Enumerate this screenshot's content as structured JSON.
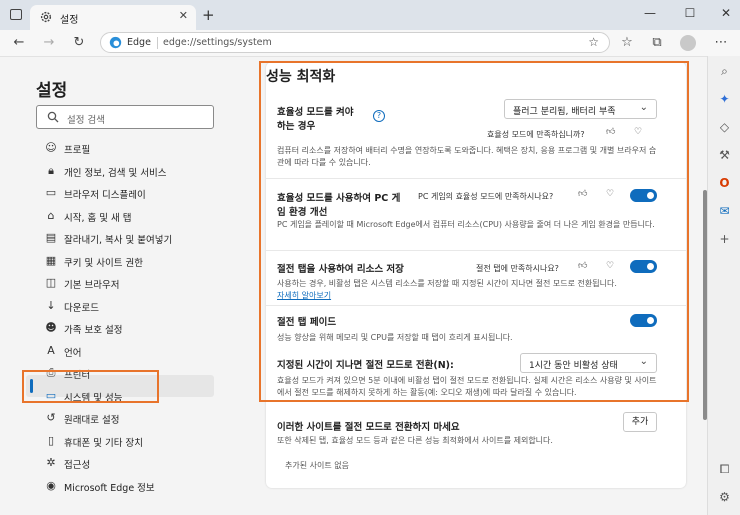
{
  "browser": {
    "tab_title": "설정",
    "new_tab": "+",
    "close": "✕",
    "minimize": "—",
    "maximize": "☐",
    "address_brand": "Edge",
    "address_url": "edge://settings/system"
  },
  "sidebar": {
    "title": "설정",
    "search_placeholder": "설정 검색",
    "items": [
      {
        "label": "프로필",
        "icon": "profile-icon"
      },
      {
        "label": "개인 정보, 검색 및 서비스",
        "icon": "lock-icon"
      },
      {
        "label": "브라우저 디스플레이",
        "icon": "display-icon"
      },
      {
        "label": "시작, 홈 및 새 탭",
        "icon": "home-icon"
      },
      {
        "label": "잘라내기, 복사 및 붙여넣기",
        "icon": "clipboard-icon"
      },
      {
        "label": "쿠키 및 사이트 권한",
        "icon": "cookie-icon"
      },
      {
        "label": "기본 브라우저",
        "icon": "browser-icon"
      },
      {
        "label": "다운로드",
        "icon": "download-icon"
      },
      {
        "label": "가족 보호 설정",
        "icon": "family-icon"
      },
      {
        "label": "언어",
        "icon": "language-icon"
      },
      {
        "label": "프린터",
        "icon": "printer-icon"
      },
      {
        "label": "시스템 및 성능",
        "icon": "system-icon",
        "active": true
      },
      {
        "label": "원래대로 설정",
        "icon": "reset-icon"
      },
      {
        "label": "휴대폰 및 기타 장치",
        "icon": "phone-icon"
      },
      {
        "label": "접근성",
        "icon": "accessibility-icon"
      },
      {
        "label": "Microsoft Edge 정보",
        "icon": "edge-icon"
      }
    ]
  },
  "main": {
    "section_title": "성능 최적화",
    "efficiency": {
      "title_line1": "효율성 모드를 켜야",
      "title_line2": "하는 경우",
      "help": "?",
      "select_value": "플러그 분리됨, 배터리 부족",
      "feedback": "효율성 모드에 만족하십니까?",
      "desc": "컴퓨터 리소스를 저장하여 배터리 수명을 연장하도록 도와줍니다. 혜택은 장치, 응용 프로그램 및 개별 브라우저 습관에 따라 다를 수 있습니다."
    },
    "gaming": {
      "title_line1": "효율성 모드를 사용하여 PC 게",
      "title_line2": "임 환경 개선",
      "feedback": "PC 게임의 효율성 모드에 만족하시나요?",
      "desc": "PC 게임을 플레이할 때 Microsoft Edge에서 컴퓨터 리소스(CPU) 사용량을 줄여 더 나은 게임 환경을 만듭니다.",
      "on": true
    },
    "sleeping": {
      "title": "절전 탭을 사용하여 리소스 저장",
      "feedback": "절전 탭에 만족하시나요?",
      "desc": "사용하는 경우, 비활성 탭은 시스템 리소스를 저장할 때 지정된 시간이 지나면 절전 모드로 전환됩니다.",
      "learn_more": "자세히 알아보기",
      "on": true
    },
    "fade": {
      "title": "절전 탭 페이드",
      "desc": "성능 향상을 위해 메모리 및 CPU를 저장할 때 탭이 흐리게 표시됩니다.",
      "on": true
    },
    "timeout": {
      "title": "지정된 시간이 지나면 절전 모드로 전환(N):",
      "select_value": "1시간 동안 비활성 상태",
      "desc": "효율성 모드가 켜져 있으면 5분 이내에 비활성 탭이 절전 모드로 전환됩니다. 실제 시간은 리소스 사용량 및 사이트에서 절전 모드를 해제하지 못하게 하는 활동(예: 오디오 재생)에 따라 달라질 수 있습니다."
    },
    "never_sleep": {
      "title": "이러한 사이트를 절전 모드로 전환하지 마세요",
      "add_button": "추가",
      "desc": "또한 삭제된 탭, 효율성 모드 등과 같은 다른 성능 최적화에서 사이트를 제외합니다.",
      "empty": "추가된 사이트 없음"
    }
  },
  "colors": {
    "accent": "#0f6cbd",
    "highlight_border": "#e8742b"
  }
}
